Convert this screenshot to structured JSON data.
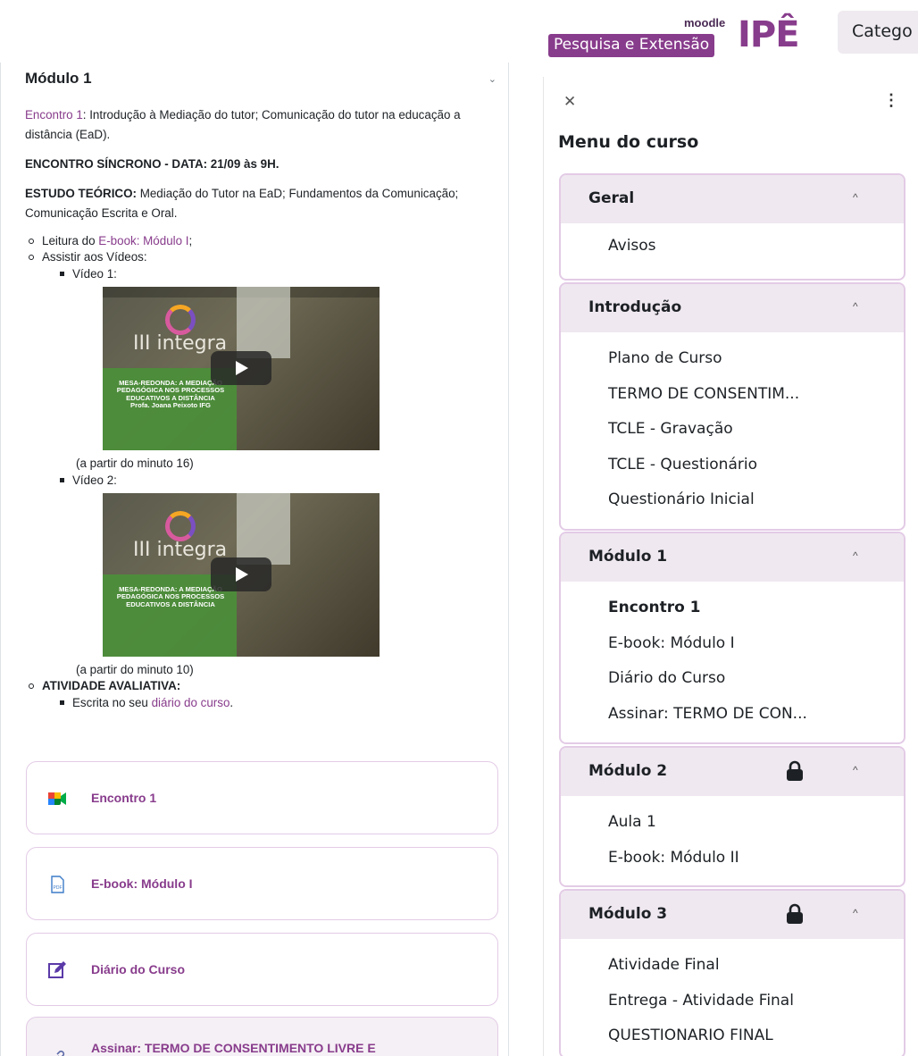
{
  "header": {
    "moodle_word": "moodle",
    "badge_text": "Pesquisa e Extensão",
    "brand_text": "IPÊ",
    "categories_button": "Catego"
  },
  "left": {
    "section_title": "Módulo 1",
    "summary": {
      "p1_link": "Encontro 1",
      "p1_text": ": Introdução à Mediação do tutor; Comunicação do tutor na educação a distância (EaD).",
      "p2": "ENCONTRO SÍNCRONO - DATA: 21/09 às 9H.",
      "p3_bold": "ESTUDO TEÓRICO:",
      "p3_text": " Mediação do Tutor na EaD; Fundamentos da Comunicação; Comunicação Escrita e Oral.",
      "reading_prefix": "Leitura do ",
      "reading_link": "E-book: Módulo I",
      "reading_suffix": ";",
      "watch": "Assistir aos Vídeos:",
      "video1_label": "Vídeo 1:",
      "video1_caption": "(a partir do minuto 16)",
      "video2_label": "Vídeo 2:",
      "video2_caption": "(a partir do minuto 10)",
      "activity_title": "ATIVIDADE AVALIATIVA:",
      "activity_prefix": "Escrita no seu ",
      "activity_link": "diário do curso",
      "activity_suffix": ".",
      "video1": {
        "brand": "III integra",
        "subtitle": "MESA-REDONDA: A MEDIAÇÃO PEDAGÓGICA NOS PROCESSOS EDUCATIVOS A DISTÂNCIA",
        "speaker": "Profa. Joana Peixoto IFG"
      },
      "video2": {
        "brand": "III integra",
        "subtitle": "MESA-REDONDA: A MEDIAÇÃO PEDAGÓGICA NOS PROCESSOS EDUCATIVOS A DISTÂNCIA"
      }
    },
    "activities": [
      {
        "name": "Encontro 1",
        "icon": "meet-icon"
      },
      {
        "name": "E-book: Módulo I",
        "icon": "pdf-icon"
      },
      {
        "name": "Diário do Curso",
        "icon": "edit-icon"
      },
      {
        "name": "Assinar: TERMO DE CONSENTIMENTO LIVRE E",
        "icon": "link-icon"
      }
    ]
  },
  "drawer": {
    "title": "Menu do curso",
    "sections": [
      {
        "title": "Geral",
        "locked": false,
        "items": [
          "Avisos"
        ]
      },
      {
        "title": "Introdução",
        "locked": false,
        "items": [
          "Plano de Curso",
          "TERMO DE CONSENTIM...",
          "TCLE - Gravação",
          "TCLE - Questionário",
          "Questionário Inicial"
        ]
      },
      {
        "title": "Módulo 1",
        "locked": false,
        "items": [
          "Encontro 1",
          "E-book: Módulo I",
          "Diário do Curso",
          "Assinar: TERMO DE CON..."
        ]
      },
      {
        "title": "Módulo 2",
        "locked": true,
        "items": [
          "Aula 1",
          "E-book: Módulo II"
        ]
      },
      {
        "title": "Módulo 3",
        "locked": true,
        "items": [
          "Atividade Final",
          "Entrega - Atividade Final",
          "QUESTIONARIO FINAL"
        ]
      }
    ],
    "current_item": "Encontro 1"
  },
  "colors": {
    "accent": "#883c8c",
    "section_bg": "#efe8f0",
    "border": "#e3cbe6"
  }
}
